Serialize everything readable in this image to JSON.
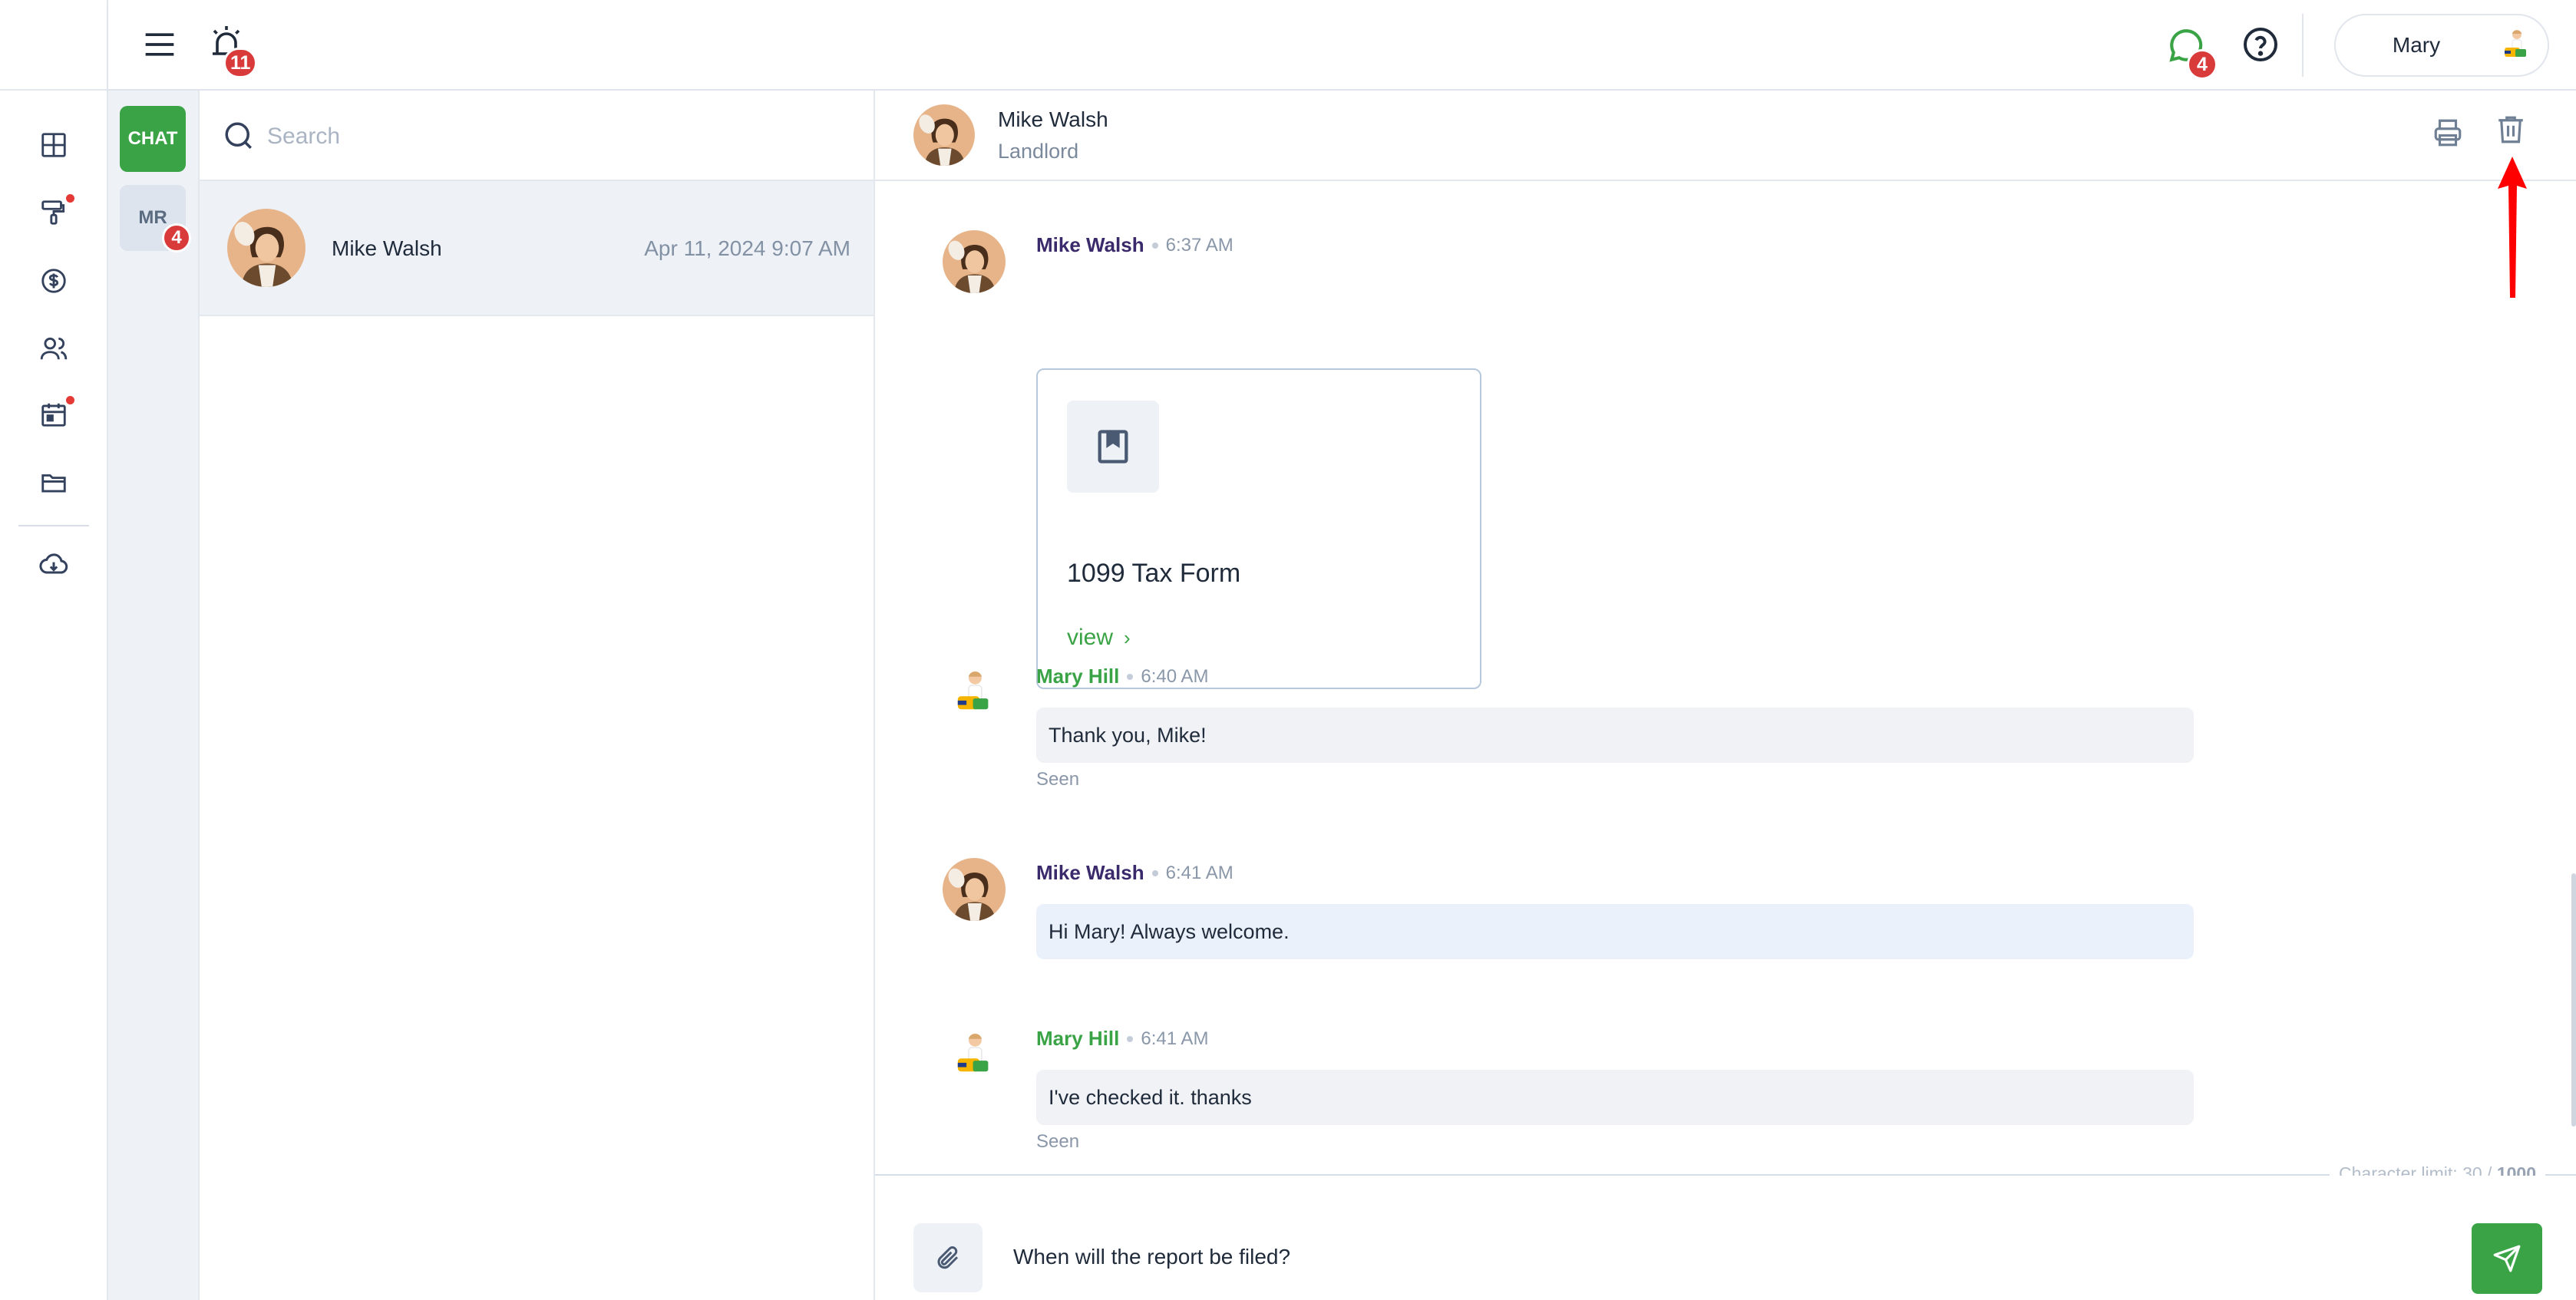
{
  "header": {
    "alerts_badge": "11",
    "chat_badge": "4",
    "user_name": "Mary"
  },
  "rail": {
    "icons": [
      "dashboard-icon",
      "paint-roller-icon",
      "dollar-icon",
      "users-icon",
      "calendar-icon",
      "folder-icon",
      "cloud-download-icon"
    ]
  },
  "chat_types": {
    "chat_label": "CHAT",
    "mr_label": "MR",
    "mr_badge": "4"
  },
  "search": {
    "placeholder": "Search"
  },
  "conversations": [
    {
      "name": "Mike Walsh",
      "date": "Apr 11, 2024 9:07 AM"
    }
  ],
  "chat_header": {
    "name": "Mike Walsh",
    "role": "Landlord"
  },
  "messages": [
    {
      "sender": "Mike Walsh",
      "time": "6:37 AM",
      "attachment": {
        "title": "1099 Tax Form",
        "action": "view"
      }
    },
    {
      "sender": "Mary Hill",
      "time": "6:40 AM",
      "text": "Thank you, Mike!",
      "status": "Seen"
    },
    {
      "sender": "Mike Walsh",
      "time": "6:41 AM",
      "text": "Hi Mary! Always welcome."
    },
    {
      "sender": "Mary Hill",
      "time": "6:41 AM",
      "text": "I've checked it. thanks",
      "status": "Seen"
    }
  ],
  "compose": {
    "char_limit_label": "Character limit: 30 /",
    "char_limit_max": "1000",
    "value": "When will the report be filed?"
  },
  "colors": {
    "brand_green": "#3aa346",
    "badge_red": "#d93a3a",
    "annotation_arrow": "#ff0000"
  }
}
